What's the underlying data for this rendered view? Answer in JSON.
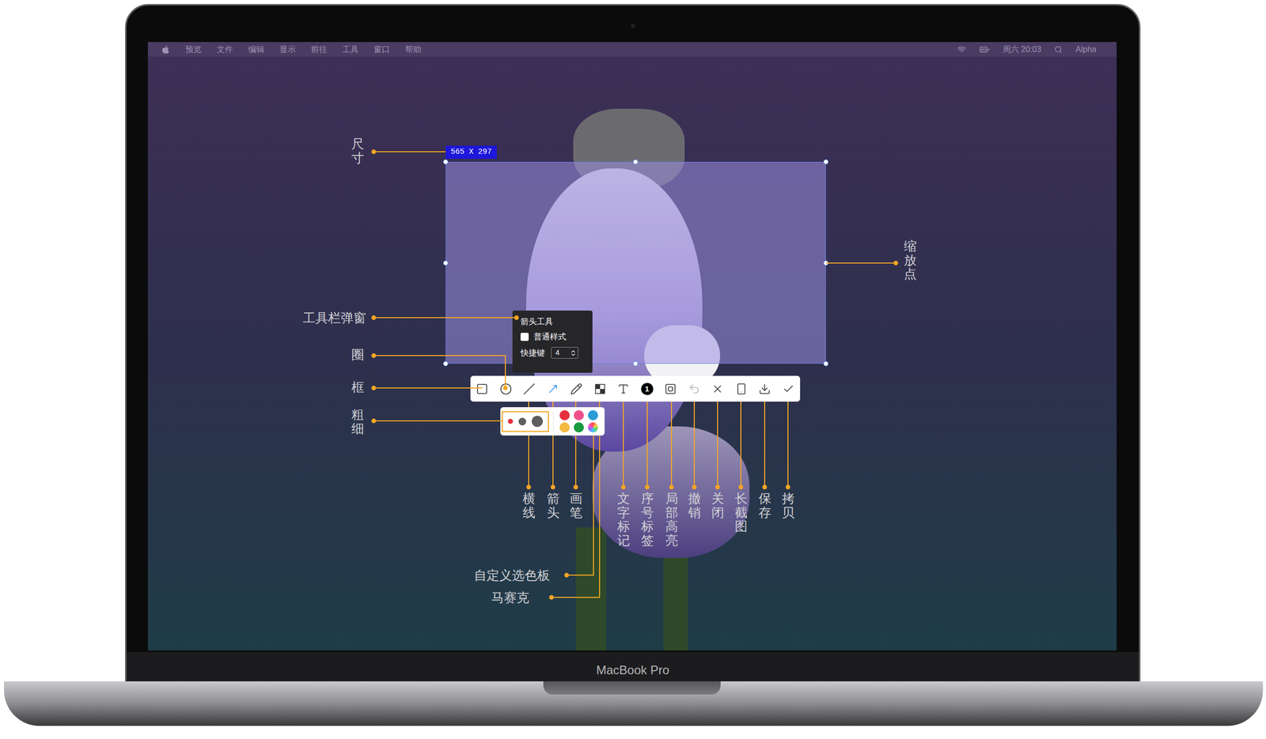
{
  "device": {
    "name": "MacBook Pro"
  },
  "menu_bar": {
    "app_menus": [
      "预览",
      "文件",
      "编辑",
      "显示",
      "前往",
      "工具",
      "窗口",
      "帮助"
    ],
    "clock": "周六 20:03",
    "user": "Alpha"
  },
  "selection": {
    "size": "565 X 297"
  },
  "popup": {
    "title": "箭头工具",
    "style_option": {
      "label": "普通样式",
      "checked": false
    },
    "shortcut": {
      "label": "快捷键",
      "value": "4"
    }
  },
  "toolbar": {
    "tools": [
      {
        "kind": "rect",
        "selected": false,
        "disabled": false
      },
      {
        "kind": "circle",
        "selected": false,
        "disabled": false
      },
      {
        "kind": "line",
        "selected": false,
        "disabled": false
      },
      {
        "kind": "arrow",
        "selected": true,
        "disabled": false
      },
      {
        "kind": "pen",
        "selected": false,
        "disabled": false
      },
      {
        "kind": "mosaic",
        "selected": false,
        "disabled": false
      },
      {
        "kind": "text",
        "selected": false,
        "disabled": false
      },
      {
        "kind": "number",
        "selected": false,
        "disabled": false,
        "glyph": "1"
      },
      {
        "kind": "highlight",
        "selected": false,
        "disabled": false
      },
      {
        "kind": "undo",
        "selected": false,
        "disabled": true
      },
      {
        "kind": "close",
        "selected": false,
        "disabled": false
      },
      {
        "kind": "long",
        "selected": false,
        "disabled": false
      },
      {
        "kind": "save",
        "selected": false,
        "disabled": false
      },
      {
        "kind": "copy",
        "selected": false,
        "disabled": false
      }
    ]
  },
  "palette": {
    "current_color": "#e8303f",
    "sizes": [
      {
        "size": "small",
        "selected": true
      },
      {
        "size": "medium",
        "selected": false
      },
      {
        "size": "large",
        "selected": false
      }
    ],
    "colors": [
      {
        "kind": "swatch",
        "color": "#e8303f",
        "selected": false
      },
      {
        "kind": "swatch",
        "color": "#ee4f8a",
        "selected": false
      },
      {
        "kind": "swatch",
        "color": "#2b9bd6",
        "selected": false
      },
      {
        "kind": "swatch",
        "color": "#f5b940",
        "selected": false
      },
      {
        "kind": "swatch",
        "color": "#199a3e",
        "selected": false
      },
      {
        "kind": "custom",
        "selected": false
      }
    ]
  },
  "annotations": [
    {
      "text": "尺寸",
      "kind": "vertical"
    },
    {
      "text": "工具栏弹窗",
      "kind": "horizontal"
    },
    {
      "text": "圈",
      "kind": "vertical"
    },
    {
      "text": "框",
      "kind": "vertical"
    },
    {
      "text": "粗细",
      "kind": "vertical"
    },
    {
      "text": "缩放点",
      "kind": "vertical"
    },
    {
      "text": "横线",
      "kind": "vertical"
    },
    {
      "text": "箭头",
      "kind": "vertical"
    },
    {
      "text": "画笔",
      "kind": "vertical"
    },
    {
      "text": "文字标记",
      "kind": "vertical"
    },
    {
      "text": "序号标签",
      "kind": "vertical"
    },
    {
      "text": "局部高亮",
      "kind": "vertical"
    },
    {
      "text": "撤销",
      "kind": "vertical"
    },
    {
      "text": "关闭",
      "kind": "vertical"
    },
    {
      "text": "长截图",
      "kind": "vertical"
    },
    {
      "text": "保存",
      "kind": "vertical"
    },
    {
      "text": "拷贝",
      "kind": "vertical"
    },
    {
      "text": "自定义选色板",
      "kind": "horizontal"
    },
    {
      "text": "马赛克",
      "kind": "horizontal"
    }
  ]
}
